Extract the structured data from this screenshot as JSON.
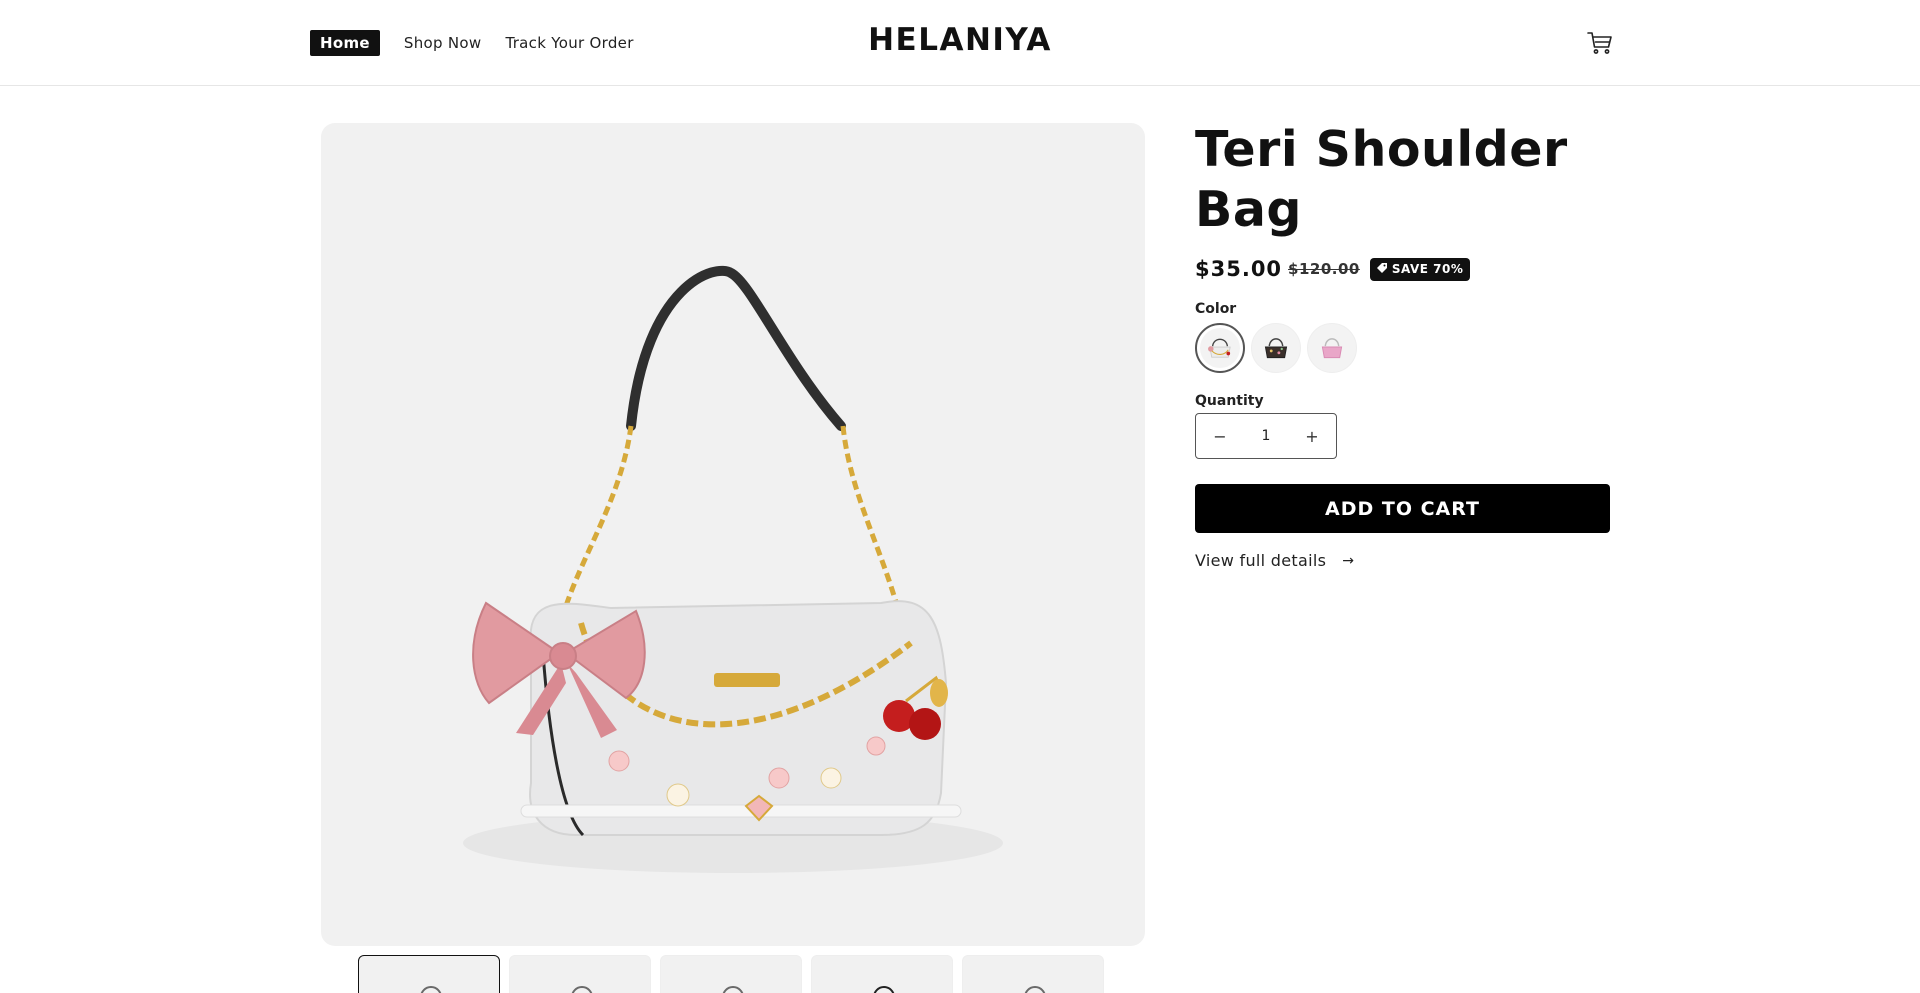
{
  "header": {
    "nav": [
      {
        "label": "Home",
        "active": true
      },
      {
        "label": "Shop Now",
        "active": false
      },
      {
        "label": "Track Your Order",
        "active": false
      }
    ],
    "logo": "HELANIYA",
    "cart_icon": "cart-icon"
  },
  "product": {
    "title": "Teri Shoulder Bag",
    "price": "$35.00",
    "compare_price": "$120.00",
    "badge": "SAVE 70%",
    "badge_icon": "tag-icon",
    "color_label": "Color",
    "swatches": [
      "white-cherry-bag",
      "black-floral-bag",
      "pink-bag"
    ],
    "quantity_label": "Quantity",
    "quantity_value": "1",
    "add_to_cart": "ADD TO CART",
    "view_details": "View full details",
    "view_details_icon": "arrow-right-icon"
  },
  "gallery": {
    "thumbnail_count": 5,
    "selected_thumbnail": 1
  },
  "colors": {
    "accent": "#000000",
    "image_bg": "#f1f1f1",
    "bow": "#e19aa0",
    "chain": "#d6a93a",
    "cherry": "#c41e1e"
  }
}
